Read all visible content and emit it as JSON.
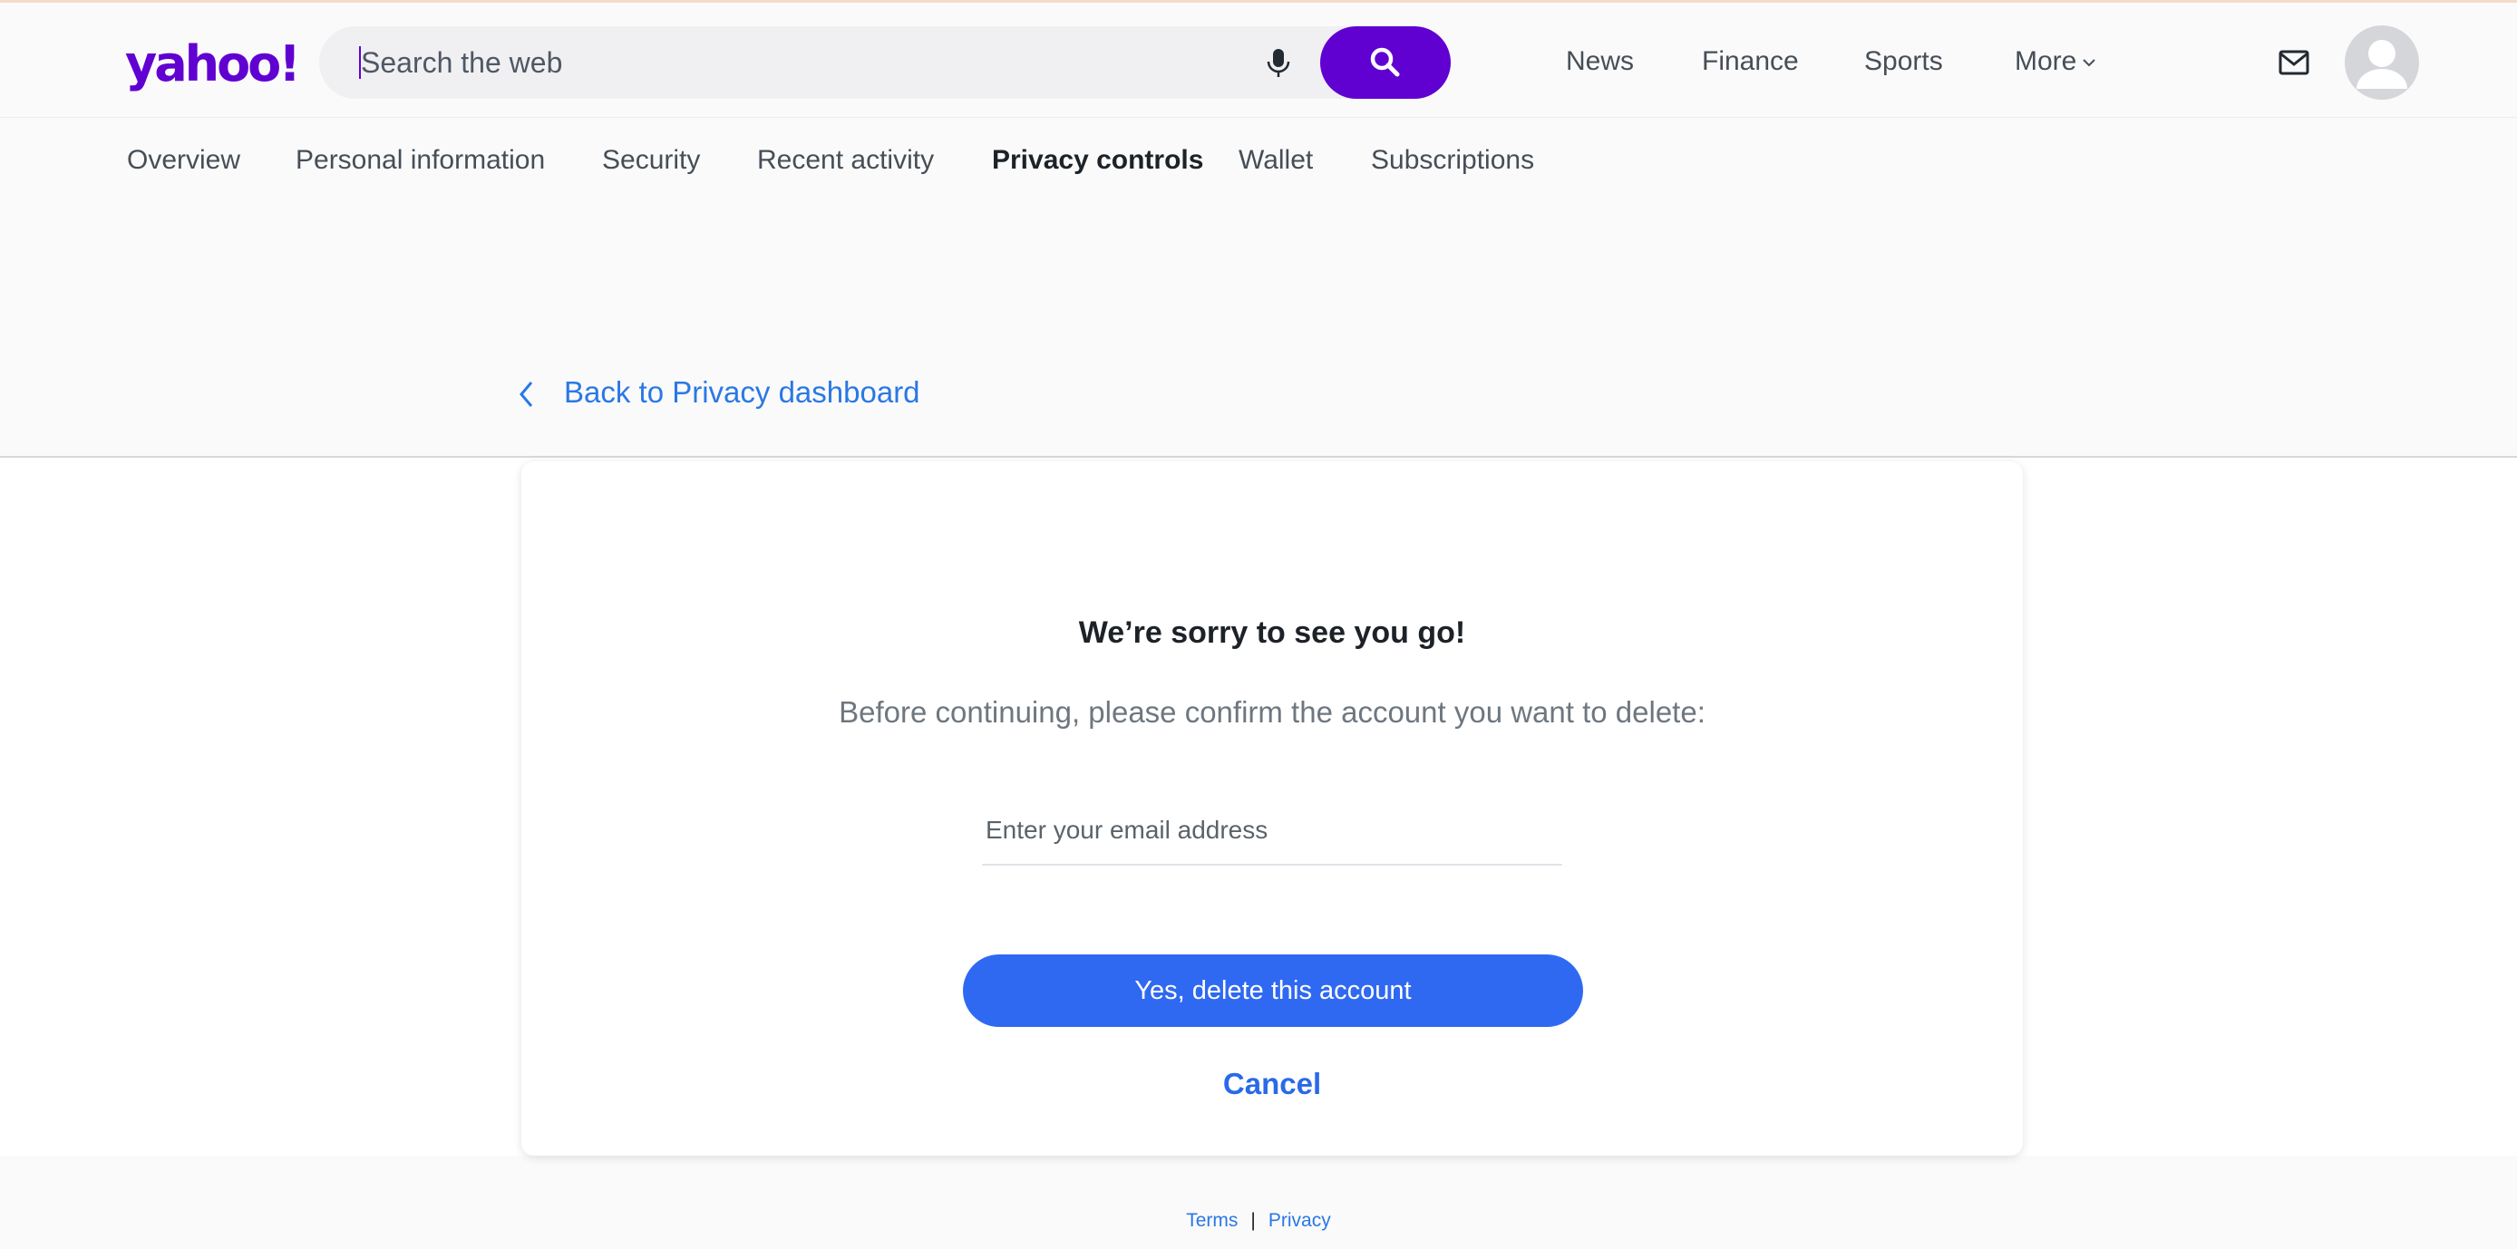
{
  "header": {
    "logo": "yahoo!",
    "search": {
      "placeholder": "Search the web",
      "value": ""
    },
    "nav": [
      "News",
      "Finance",
      "Sports",
      "More"
    ]
  },
  "subnav": {
    "items": [
      "Overview",
      "Personal information",
      "Security",
      "Recent activity",
      "Privacy controls",
      "Wallet",
      "Subscriptions"
    ],
    "active": "Privacy controls"
  },
  "back_link": "Back to Privacy dashboard",
  "card": {
    "title": "We’re sorry to see you go!",
    "subtitle": "Before continuing, please confirm the account you want to delete:",
    "email_placeholder": "Enter your email address",
    "email_value": "",
    "delete_label": "Yes, delete this account",
    "cancel_label": "Cancel"
  },
  "footer": {
    "terms": "Terms",
    "separator": "|",
    "privacy": "Privacy"
  },
  "colors": {
    "brand": "#6001d2",
    "primary_button": "#2f69f2",
    "link": "#2a78e4"
  }
}
